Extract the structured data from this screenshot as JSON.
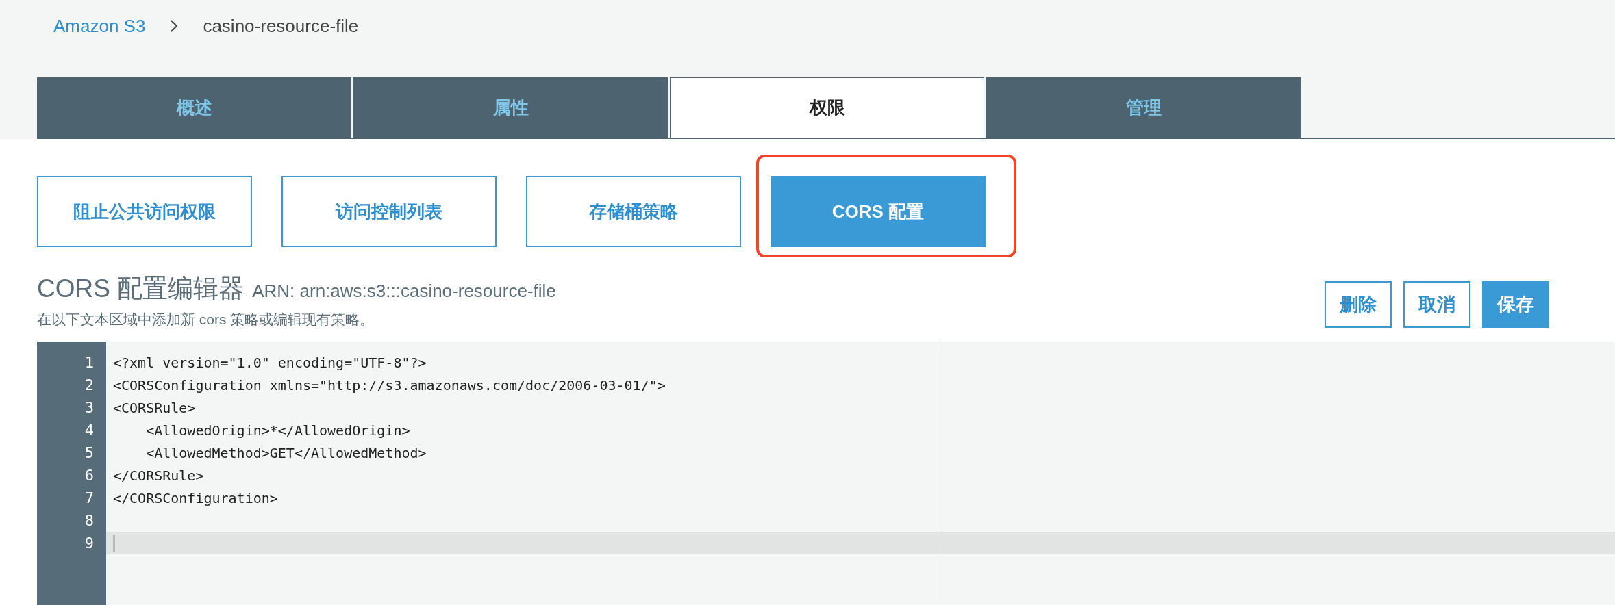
{
  "breadcrumb": [
    {
      "label": "Amazon S3",
      "kind": "link"
    },
    {
      "label": "casino-resource-file",
      "kind": "current"
    }
  ],
  "tabs": [
    {
      "label": "概述",
      "selected": false
    },
    {
      "label": "属性",
      "selected": false
    },
    {
      "label": "权限",
      "selected": true
    },
    {
      "label": "管理",
      "selected": false
    }
  ],
  "sub_tabs": [
    {
      "label": "阻止公共访问权限",
      "selected": false,
      "highlighted": false
    },
    {
      "label": "访问控制列表",
      "selected": false,
      "highlighted": false
    },
    {
      "label": "存储桶策略",
      "selected": false,
      "highlighted": false
    },
    {
      "label": "CORS 配置",
      "selected": true,
      "highlighted": true
    }
  ],
  "editor": {
    "title": "CORS 配置编辑器",
    "arn": "ARN: arn:aws:s3:::casino-resource-file",
    "description": "在以下文本区域中添加新 cors 策略或编辑现有策略。",
    "actions": [
      {
        "label": "删除",
        "kind": "outline"
      },
      {
        "label": "取消",
        "kind": "outline"
      },
      {
        "label": "保存",
        "kind": "primary"
      }
    ],
    "cursor_on_last_line": true,
    "lines": [
      {
        "number": "1",
        "text": "<?xml version=\"1.0\" encoding=\"UTF-8\"?>"
      },
      {
        "number": "2",
        "text": "<CORSConfiguration xmlns=\"http://s3.amazonaws.com/doc/2006-03-01/\">"
      },
      {
        "number": "3",
        "text": "<CORSRule>"
      },
      {
        "number": "4",
        "text": "    <AllowedOrigin>*</AllowedOrigin>"
      },
      {
        "number": "5",
        "text": "    <AllowedMethod>GET</AllowedMethod>"
      },
      {
        "number": "6",
        "text": "</CORSRule>"
      },
      {
        "number": "7",
        "text": "</CORSConfiguration>"
      },
      {
        "number": "8"
      },
      {
        "number": "9"
      }
    ]
  }
}
